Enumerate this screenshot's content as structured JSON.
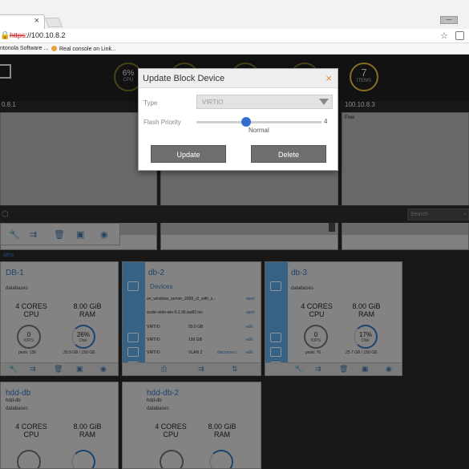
{
  "browser": {
    "tab_close": "×",
    "address": {
      "scheme": "https",
      "rest": "://100.10.8.2"
    },
    "bookmarks": [
      "ntonola Software ...",
      "Real console on Link..."
    ],
    "window_control": "—"
  },
  "header": {
    "stats": [
      {
        "value": "6%",
        "label": "CPU"
      },
      {
        "value": "7",
        "label": "ITEMS"
      }
    ],
    "hosts": [
      "0.8.1",
      "100.10.8.3"
    ],
    "host_free": "Free"
  },
  "toolbar": {
    "search_placeholder": "Search"
  },
  "group_label": "athe",
  "cards": {
    "db1": {
      "name": "DB-1",
      "tag": "databases",
      "cores_value": "4 CORES",
      "cores_label": "CPU",
      "ram_value": "8.00 GiB",
      "ram_label": "RAM",
      "iops_value": "0",
      "iops_label": "IOPS",
      "iops_caption": "peak: 136",
      "disk_value": "26%",
      "disk_label": "Disk",
      "disk_caption": "39.8 GB / 150 GB"
    },
    "db2": {
      "name": "db-2",
      "devices_header": "Devices",
      "devices": [
        {
          "name": "en_windows_server_2008_r2_with_s...",
          "action": "eject"
        },
        {
          "name": "scale-virtio-win-0.1.96.iso82.iso",
          "action": "eject"
        },
        {
          "name": "VIRTIO",
          "size": "50.0 GB",
          "action": "edit"
        },
        {
          "name": "VIRTIO",
          "size": "100 GB",
          "action": "edit"
        },
        {
          "name": "VIRTIO",
          "size": "VLAN 2",
          "action": "disconnect",
          "action2": "edit"
        }
      ]
    },
    "db3": {
      "name": "db-3",
      "tag": "databases",
      "cores_value": "4 CORES",
      "cores_label": "CPU",
      "ram_value": "8.00 GiB",
      "ram_label": "RAM",
      "iops_value": "0",
      "iops_label": "IOPS",
      "iops_caption": "peak: 76",
      "disk_value": "17%",
      "disk_label": "Disk",
      "disk_caption": "25.7 GB / 150 GB"
    },
    "hdd1": {
      "name": "hdd-db",
      "tag": "hdd-db",
      "tag2": "databases",
      "cores_value": "4 CORES",
      "cores_label": "CPU",
      "ram_value": "8.00 GiB",
      "ram_label": "RAM"
    },
    "hdd2": {
      "name": "hdd-db-2",
      "tag": "hdd-db",
      "tag2": "databases",
      "cores_value": "4 CORES",
      "cores_label": "CPU",
      "ram_value": "8.00 GiB",
      "ram_label": "RAM"
    }
  },
  "modal": {
    "title": "Update Block Device",
    "close": "×",
    "type_label": "Type",
    "type_value": "VIRTIO",
    "flash_label": "Flash Priority",
    "flash_value": "4",
    "flash_level": 0.4,
    "flash_text": "Normal",
    "update_button": "Update",
    "delete_button": "Delete"
  }
}
